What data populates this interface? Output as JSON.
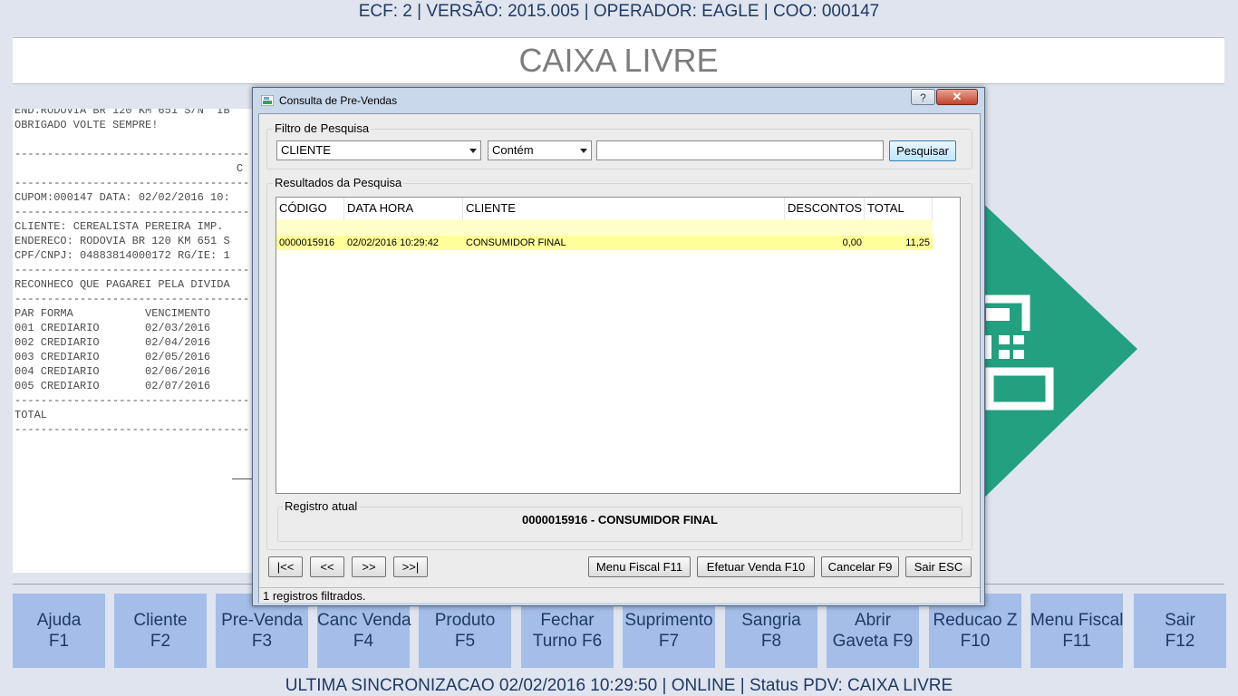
{
  "header": {
    "info": "ECF: 2 | VERSÃO: 2015.005 | OPERADOR: EAGLE | COO: 000147"
  },
  "title": "CAIXA LIVRE",
  "receipt": {
    "lines": "END.RODOVIA BR 120 KM 651 S/N  IB\nOBRIGADO VOLTE SEMPRE!\n\n------------------------------------\n                                  C\n------------------------------------\nCUPOM:000147 DATA: 02/02/2016 10:\n------------------------------------\nCLIENTE: CEREALISTA PEREIRA IMP.\nENDERECO: RODOVIA BR 120 KM 651 S\nCPF/CNPJ: 04883814000172 RG/IE: 1\n------------------------------------\nRECONHECO QUE PAGAREI PELA DIVIDA\n------------------------------------\nPAR FORMA           VENCIMENTO\n001 CREDIARIO       02/03/2016\n002 CREDIARIO       02/04/2016\n003 CREDIARIO       02/05/2016\n004 CREDIARIO       02/06/2016\n005 CREDIARIO       02/07/2016\n------------------------------------\nTOTAL\n------------------------------------"
  },
  "logo": {
    "color": "#23a080",
    "icon": "cash-register-icon"
  },
  "dialog": {
    "title": "Consulta de Pre-Vendas",
    "help_label": "?",
    "close_label": "✕",
    "filter": {
      "group_title": "Filtro de Pesquisa",
      "field_value": "CLIENTE",
      "operator_value": "Contém",
      "search_value": "",
      "search_button": "Pesquisar"
    },
    "results": {
      "group_title": "Resultados da Pesquisa",
      "columns": [
        "CÓDIGO",
        "DATA HORA",
        "CLIENTE",
        "DESCONTOS",
        "TOTAL"
      ],
      "rows": [
        [
          "0000015916",
          "02/02/2016 10:29:42",
          "CONSUMIDOR FINAL",
          "0,00",
          "11,25"
        ]
      ]
    },
    "registro": {
      "group_title": "Registro atual",
      "value": "0000015916 - CONSUMIDOR FINAL"
    },
    "nav": {
      "first": "|<<",
      "prev": "<<",
      "next": ">>",
      "last": ">>|"
    },
    "actions": {
      "menu_fiscal": "Menu Fiscal F11",
      "efetuar_venda": "Efetuar Venda F10",
      "cancelar": "Cancelar F9",
      "sair": "Sair ESC"
    },
    "status": "1 registros filtrados."
  },
  "fkeys": [
    {
      "line1": "Ajuda",
      "line2": "F1"
    },
    {
      "line1": "Cliente",
      "line2": "F2"
    },
    {
      "line1": "Pre-Venda",
      "line2": "F3"
    },
    {
      "line1": "Canc Venda",
      "line2": "F4"
    },
    {
      "line1": "Produto",
      "line2": "F5"
    },
    {
      "line1": "Fechar",
      "line2": "Turno F6"
    },
    {
      "line1": "Suprimento",
      "line2": "F7"
    },
    {
      "line1": "Sangria",
      "line2": "F8"
    },
    {
      "line1": "Abrir",
      "line2": "Gaveta F9"
    },
    {
      "line1": "Reducao Z",
      "line2": "F10"
    },
    {
      "line1": "Menu Fiscal",
      "line2": "F11"
    },
    {
      "line1": "Sair",
      "line2": "F12"
    }
  ],
  "status_bar": "ULTIMA SINCRONIZACAO 02/02/2016 10:29:50 | ONLINE | Status PDV: CAIXA LIVRE"
}
